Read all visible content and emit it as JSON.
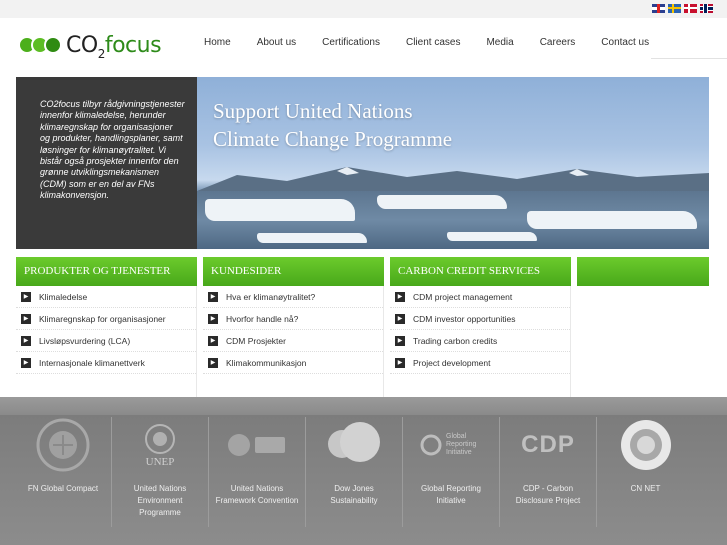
{
  "languages": [
    {
      "name": "English",
      "icon": "uk-flag-icon"
    },
    {
      "name": "Svenska",
      "icon": "sweden-flag-icon"
    },
    {
      "name": "Dansk",
      "icon": "denmark-flag-icon"
    },
    {
      "name": "Norsk",
      "icon": "norway-flag-icon"
    }
  ],
  "logo": {
    "co": "CO",
    "two": "2",
    "focus": "focus"
  },
  "nav": [
    "Home",
    "About us",
    "Certifications",
    "Client cases",
    "Media",
    "Careers",
    "Contact us"
  ],
  "intro": {
    "text": "CO2focus tilbyr rådgivningstjenester innenfor klimaledelse, herunder klimaregnskap for organisasjoner og produkter, handlingsplaner, samt løsninger for klimanøytralitet. Vi bistår også prosjekter innenfor den grønne utviklingsmekanismen (CDM) som er en del av FNs klimakonvensjon."
  },
  "hero": {
    "line1": "Support United Nations",
    "line2": "Climate Change Programme"
  },
  "columns": [
    {
      "title": "PRODUKTER OG TJENESTER",
      "items": [
        "Klimaledelse",
        "Klimaregnskap for organisasjoner",
        "Livsløpsvurdering (LCA)",
        "Internasjonale klimanettverk"
      ]
    },
    {
      "title": "KUNDESIDER",
      "items": [
        "Hva er klimanøytralitet?",
        "Hvorfor handle nå?",
        "CDM Prosjekter",
        "Klimakommunikasjon"
      ]
    },
    {
      "title": "CARBON CREDIT SERVICES",
      "items": [
        "CDM project management",
        "CDM investor opportunities",
        "Trading carbon credits",
        "Project development"
      ]
    },
    {
      "title": "",
      "items": []
    }
  ],
  "partners": [
    {
      "label": "FN Global Compact",
      "icon": "global-compact-icon"
    },
    {
      "label": "United Nations Environment Programme",
      "icon": "unep-icon",
      "emblem_text": "UNEP"
    },
    {
      "label": "United Nations Framework Convention",
      "icon": "unfccc-icon"
    },
    {
      "label": "Dow Jones Sustainability",
      "icon": "dow-jones-icon"
    },
    {
      "label": "Global Reporting Initiative",
      "icon": "gri-icon",
      "emblem_text": "Global Reporting Initiative"
    },
    {
      "label": "CDP - Carbon Disclosure Project",
      "icon": "cdp-icon",
      "emblem_text": "CDP"
    },
    {
      "label": "CN NET",
      "icon": "cn-net-icon"
    }
  ],
  "colors": {
    "green": "#4caf1b",
    "dark_panel": "#3a3a3a",
    "footer": "#808080"
  }
}
